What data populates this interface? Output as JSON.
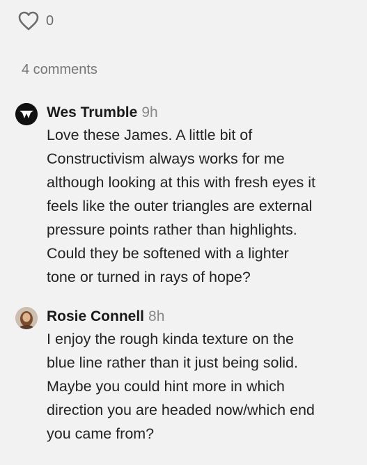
{
  "likes": {
    "count": "0"
  },
  "comments_header": {
    "count_label": "4 comments"
  },
  "comments": [
    {
      "author": "Wes Trumble",
      "time": "9h",
      "avatar_icon": "wes-trumble-logo-icon",
      "lines": [
        "Love these James. A little bit of",
        "Constructivism always works for me",
        "although looking at this with fresh eyes it",
        "feels like the outer triangles are external",
        "pressure points rather than highlights.",
        "Could they be softened with a lighter",
        "tone or turned in rays of hope?"
      ]
    },
    {
      "author": "Rosie Connell",
      "time": "8h",
      "avatar_icon": "rosie-connell-avatar",
      "lines": [
        "I enjoy the rough kinda texture on the",
        "blue line rather than it just being solid.",
        "Maybe you could hint more in which",
        "direction you are headed now/which end",
        "you came from?"
      ]
    }
  ],
  "colors": {
    "background": "#f2f2f2",
    "text": "#1a1a1a",
    "muted": "#888888"
  }
}
